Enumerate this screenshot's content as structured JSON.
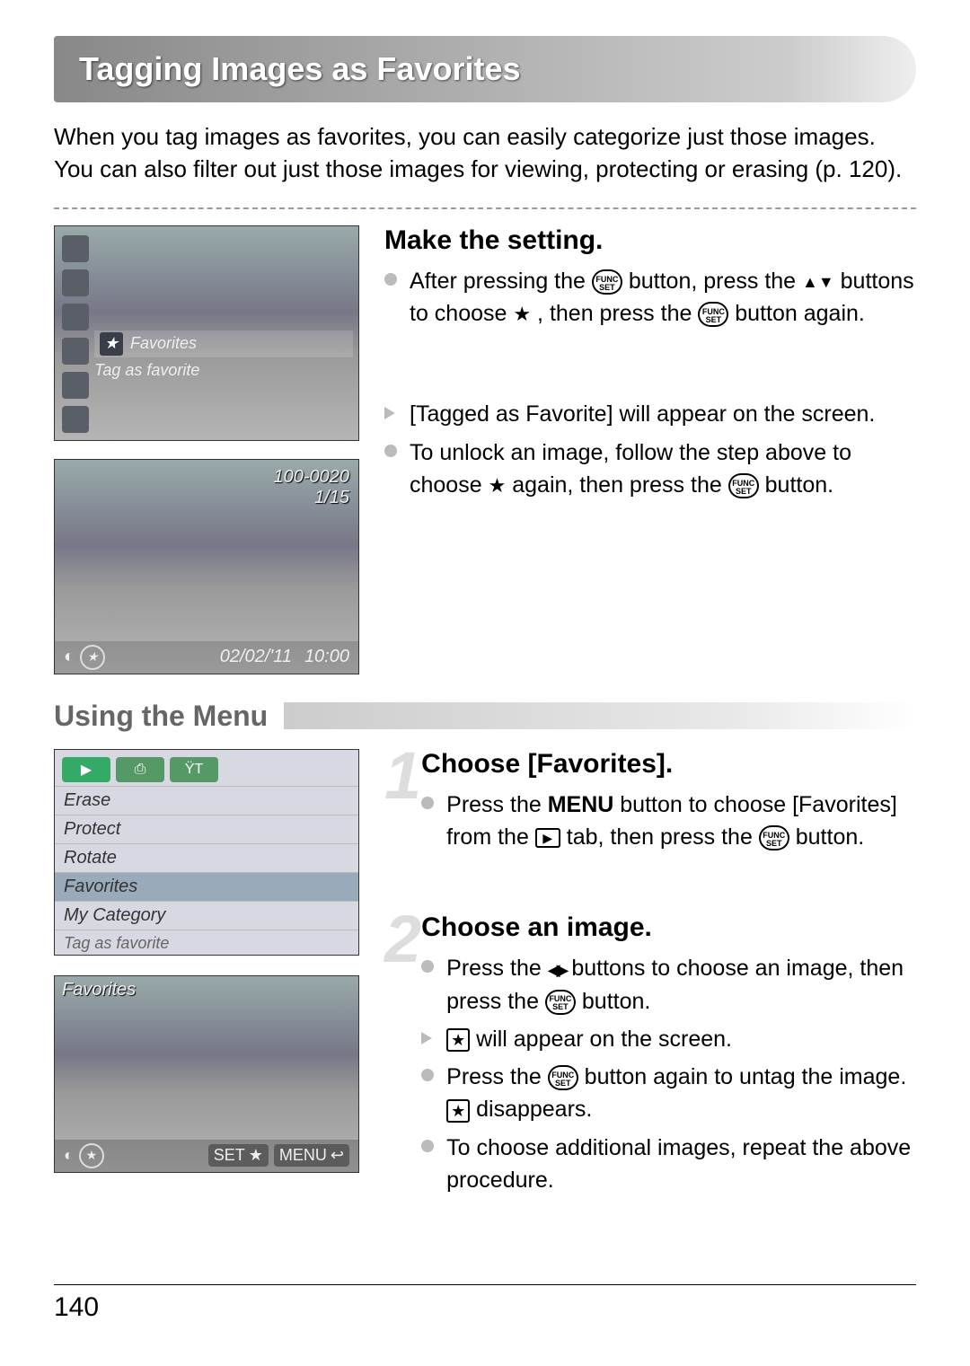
{
  "title": "Tagging Images as Favorites",
  "intro": "When you tag images as favorites, you can easily categorize just those images. You can also filter out just those images for viewing, protecting or erasing (p. 120).",
  "shot1": {
    "highlight_label": "Favorites",
    "sub_label": "Tag as favorite"
  },
  "shot2": {
    "img_num": "100-0020",
    "count": "1/15",
    "date": "02/02/'11",
    "time": "10:00"
  },
  "step1": {
    "heading": "Make the setting.",
    "b1a": "After pressing the ",
    "b1b": " button, press the ",
    "b1c": " buttons to choose ",
    "b1d": " , then press the ",
    "b1e": " button again.",
    "b2": "[Tagged as Favorite] will appear on the screen.",
    "b3a": "To unlock an image, follow the step above to choose ",
    "b3b": " again, then press the ",
    "b3c": " button."
  },
  "section2_heading": "Using the Menu",
  "shot3": {
    "items": [
      "Erase",
      "Protect",
      "Rotate",
      "Favorites",
      "My Category"
    ],
    "hint": "Tag as favorite"
  },
  "step2": {
    "num": "1",
    "heading": "Choose [Favorites].",
    "b1a": "Press the ",
    "menu_word": "MENU",
    "b1b": " button to choose [Favorites] from the ",
    "b1c": " tab, then press the ",
    "b1d": " button."
  },
  "shot4": {
    "label": "Favorites",
    "set": "SET",
    "menu": "MENU"
  },
  "step3": {
    "num": "2",
    "heading": "Choose an image.",
    "b1a": "Press the ",
    "b1b": " buttons to choose an image, then press the ",
    "b1c": " button.",
    "b2a": " will appear on the screen.",
    "b3a": "Press the ",
    "b3b": " button again to untag the image. ",
    "b3c": " disappears.",
    "b4": "To choose additional images, repeat the above procedure."
  },
  "page_number": "140",
  "icon_func_top": "FUNC",
  "icon_func_bot": "SET"
}
